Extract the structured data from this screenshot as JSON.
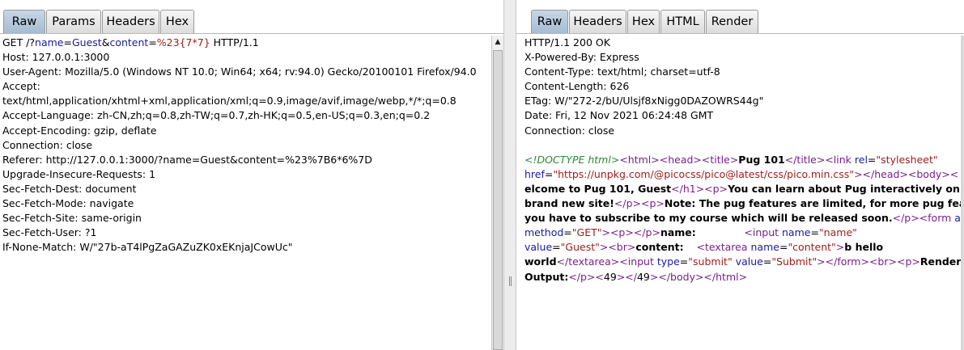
{
  "request": {
    "tabs": [
      "Raw",
      "Params",
      "Headers",
      "Hex"
    ],
    "active_tab": "Raw",
    "line1": {
      "method_start": "GET /?",
      "k1": "name",
      "eq1": "=",
      "v1": "Guest",
      "amp": "&",
      "k2": "content",
      "eq2": "=",
      "v2": "%23{7*7}",
      "rest": " HTTP/1.1"
    },
    "lines": [
      "Host: 127.0.0.1:3000",
      "User-Agent: Mozilla/5.0 (Windows NT 10.0; Win64; x64; rv:94.0) Gecko/20100101 Firefox/94.0",
      "Accept:",
      "text/html,application/xhtml+xml,application/xml;q=0.9,image/avif,image/webp,*/*;q=0.8",
      "Accept-Language: zh-CN,zh;q=0.8,zh-TW;q=0.7,zh-HK;q=0.5,en-US;q=0.3,en;q=0.2",
      "Accept-Encoding: gzip, deflate",
      "Connection: close",
      "Referer: http://127.0.0.1:3000/?name=Guest&content=%23%7B6*6%7D",
      "Upgrade-Insecure-Requests: 1",
      "Sec-Fetch-Dest: document",
      "Sec-Fetch-Mode: navigate",
      "Sec-Fetch-Site: same-origin",
      "Sec-Fetch-User: ?1",
      "If-None-Match: W/\"27b-aT4lPgZaGAZuZK0xEKnjaJCowUc\""
    ]
  },
  "response": {
    "tabs": [
      "Raw",
      "Headers",
      "Hex",
      "HTML",
      "Render"
    ],
    "active_tab": "Raw",
    "headers": [
      "HTTP/1.1 200 OK",
      "X-Powered-By: Express",
      "Content-Type: text/html; charset=utf-8",
      "Content-Length: 626",
      "ETag: W/\"272-2/bU/Ulsjf8xNigg0DAZOWRS44g\"",
      "Date: Fri, 12 Nov 2021 06:24:48 GMT",
      "Connection: close"
    ],
    "body": {
      "doctype": "<!DOCTYPE html>",
      "title": "Pug 101",
      "link_rel": "\"stylesheet\"",
      "link_href": "\"https://unpkg.com/@picocss/pico@latest/css/pico.min.css\"",
      "h1_text": "elcome to Pug 101, Guest",
      "p1_text_a": "You can learn about Pug interactively on my",
      "p1_text_b": "brand new site!",
      "p2_text_a": "Note: The pug features are limited, for more pug featur",
      "p2_text_b": "you have to subscribe to my course which will be released soon.",
      "form_method": "\"GET\"",
      "label_name": "name:",
      "input_name_attr": "\"name\"",
      "input_value": "\"Guest\"",
      "label_content": "content:",
      "textarea_name": "\"content\"",
      "textarea_text_a": "b hello",
      "textarea_text_b": "world",
      "submit_type": "\"submit\"",
      "submit_value": "\"Submit\"",
      "rendered_a": "Rendere",
      "rendered_b": "Output:",
      "output": "49"
    }
  }
}
